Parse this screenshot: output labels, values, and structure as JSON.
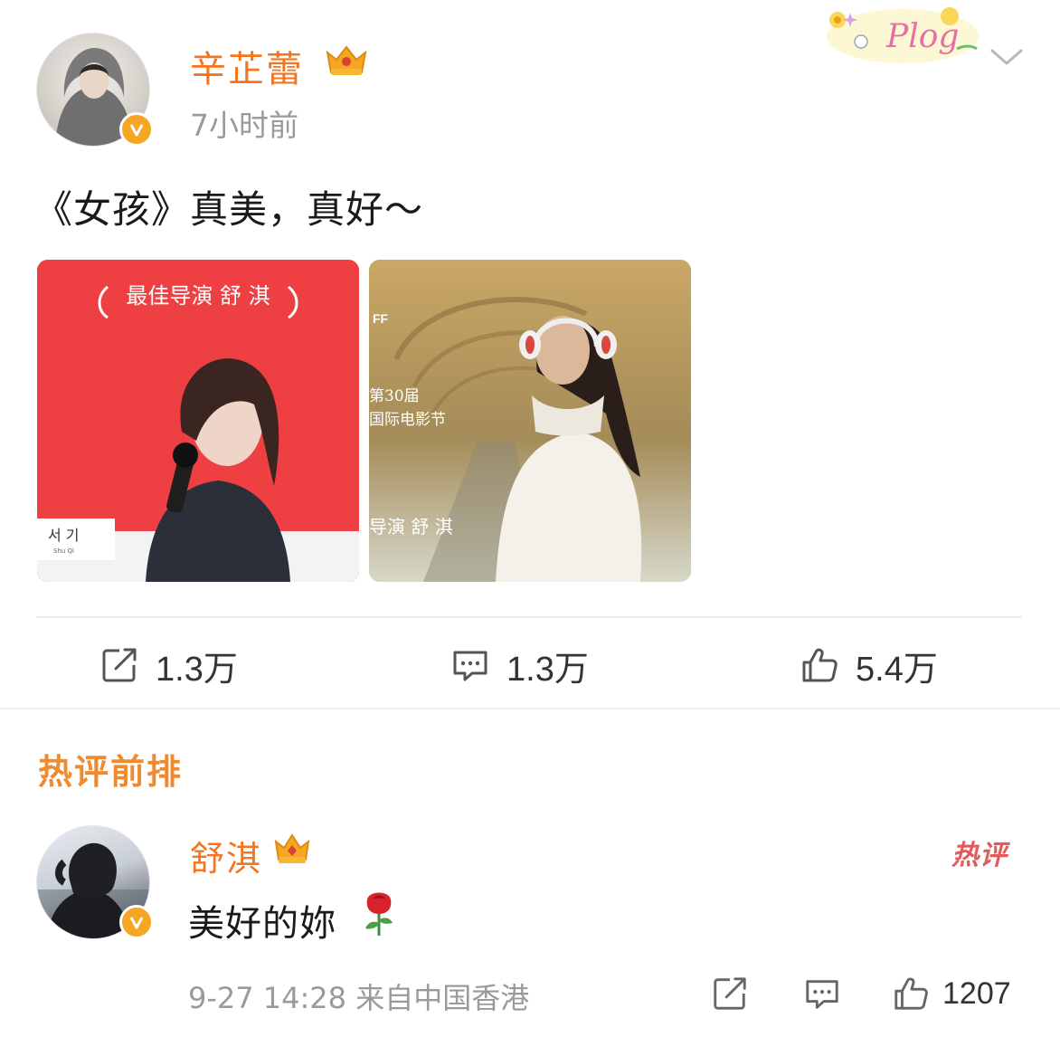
{
  "post": {
    "username": "辛芷蕾",
    "time": "7小时前",
    "text": "《女孩》真美，真好～",
    "sticker_text": "Plog",
    "images": [
      {
        "award_text": "最佳导演 舒 淇",
        "nameplate_korean": "서 기",
        "nameplate_roman": "Shu Qi"
      },
      {
        "festival_logo": "FF",
        "festival_line1": "第30届",
        "festival_line2": "国际电影节",
        "award_text": "导演 舒 淇"
      }
    ],
    "actions": {
      "repost_count": "1.3万",
      "comment_count": "1.3万",
      "like_count": "5.4万"
    }
  },
  "hot_comments": {
    "title": "热评前排",
    "items": [
      {
        "username": "舒淇",
        "badge": "热评",
        "text": "美好的妳",
        "meta": "9-27 14:28 来自中国香港",
        "like_count": "1207"
      }
    ]
  },
  "colors": {
    "username_orange": "#f4741f",
    "section_title": "#f08a2e",
    "hot_badge": "#e25a5a",
    "photo_red": "#ee3f42"
  },
  "icons": [
    "verified-icon",
    "crown-badge-icon",
    "chevron-down-icon",
    "repost-icon",
    "comment-icon",
    "like-icon",
    "rose-icon"
  ]
}
